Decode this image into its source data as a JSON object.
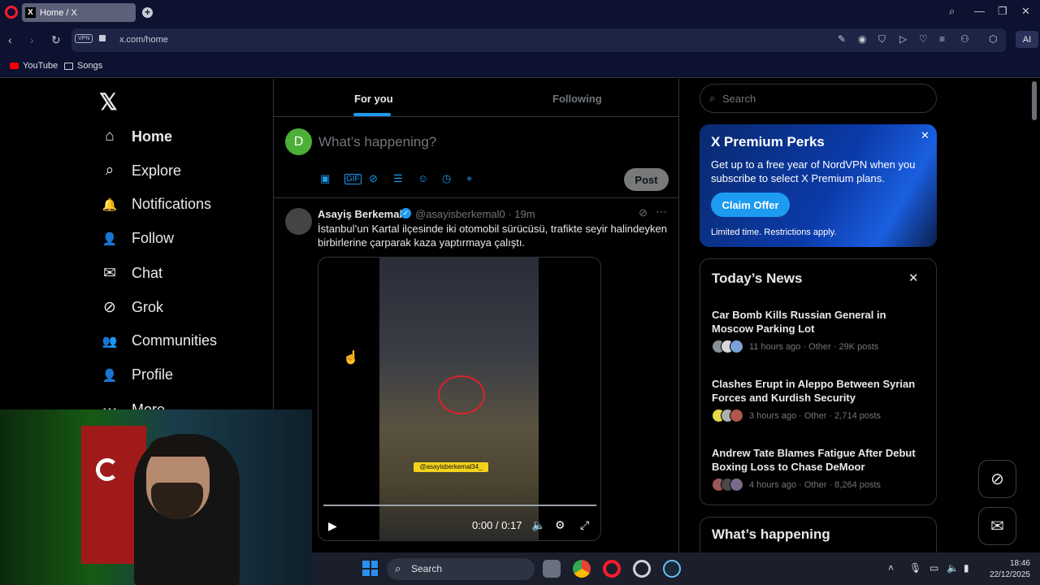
{
  "browser": {
    "tab_title": "Home / X",
    "tab_favicon": "X",
    "new_tab": "+",
    "url": "x.com/home",
    "vpn_label": "VPN",
    "ai_label": "AI",
    "bookmarks": [
      {
        "label": "YouTube",
        "icon": "youtube-icon"
      },
      {
        "label": "Songs",
        "icon": "folder-icon"
      }
    ]
  },
  "nav": {
    "logo": "𝕏",
    "items": [
      {
        "label": "Home",
        "icon": "⌂"
      },
      {
        "label": "Explore",
        "icon": "⌕"
      },
      {
        "label": "Notifications",
        "icon": "🔔"
      },
      {
        "label": "Follow",
        "icon": "👤"
      },
      {
        "label": "Chat",
        "icon": "✉"
      },
      {
        "label": "Grok",
        "icon": "⊘"
      },
      {
        "label": "Communities",
        "icon": "👥"
      },
      {
        "label": "Profile",
        "icon": "👤"
      },
      {
        "label": "More",
        "icon": "⋯"
      }
    ]
  },
  "feed": {
    "tabs": {
      "for_you": "For you",
      "following": "Following"
    },
    "compose": {
      "avatar_letter": "D",
      "placeholder": "What’s happening?",
      "post_label": "Post"
    },
    "tweet": {
      "name": "Asayiş Berkemal",
      "handle": "@asayisberkemal0 · 19m",
      "text": "İstanbul’un Kartal ilçesinde iki otomobil sürücüsü, trafikte seyir halindeyken birbirlerine çarparak kaza yaptırmaya çalıştı.",
      "video_tag": "@asayisberkemal34_",
      "video_time": "0:00 / 0:17",
      "video_progress": 0
    }
  },
  "sidebar": {
    "search_placeholder": "Search",
    "premium": {
      "title": "X Premium Perks",
      "text": "Get up to a free year of NordVPN when you subscribe to select X Premium plans.",
      "cta": "Claim Offer",
      "footer": "Limited time. Restrictions apply."
    },
    "news": {
      "title": "Today’s News",
      "items": [
        {
          "headline": "Car Bomb Kills Russian General in Moscow Parking Lot",
          "meta": "11 hours ago · Other · 29K posts"
        },
        {
          "headline": "Clashes Erupt in Aleppo Between Syrian Forces and Kurdish Security",
          "meta": "3 hours ago · Other · 2,714 posts"
        },
        {
          "headline": "Andrew Tate Blames Fatigue After Debut Boxing Loss to Chase DeMoor",
          "meta": "4 hours ago · Other · 8,264 posts"
        }
      ]
    },
    "happening_title": "What’s happening"
  },
  "taskbar": {
    "search": "Search",
    "time": "18:46",
    "date": "22/12/2025"
  },
  "colors": {
    "accent": "#1d9bf0",
    "background": "#000000",
    "browser_chrome": "#0c1230"
  }
}
